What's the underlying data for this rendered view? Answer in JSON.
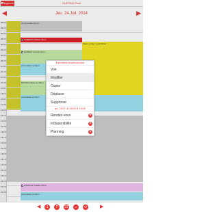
{
  "topbar": {
    "agenda_label": "Agenda",
    "doctor_name": "DUPONG Paul",
    "date": "Jeu. 24 Juil. 2014",
    "prev_arrow": "◀",
    "next_arrow": "▶"
  },
  "hours": [
    "08:00",
    "08:15",
    "08:30",
    "08:45",
    "09:00",
    "09:15",
    "09:30",
    "09:45",
    "10:00",
    "10:15",
    "10:30",
    "10:45",
    "11:00",
    "11:15",
    "11:30",
    "11:45",
    "12:00",
    "12:15",
    "12:30",
    "12:45",
    "13:00",
    "13:15",
    "13:30",
    "13:45",
    "14:00",
    "14:15",
    "14:30",
    "14:45",
    "15:00",
    "15:15",
    "15:30",
    "15:45"
  ],
  "appointments": [
    {
      "label": "[Indisponible] 30mn",
      "color": "#cfcfcf"
    },
    {
      "label": "ALBERTIN Michel   30mn",
      "color": "#e0202a"
    },
    {
      "label": "ROBERT Francis   30mn",
      "color": "#c8ecac"
    },
    {
      "label": "[Consultation] 30mn",
      "color": "#9fe3f2"
    },
    {
      "label": "MUNOZ Fabienne   30mn",
      "color": "#c8ecac"
    },
    {
      "label": "[Consultation] 30mn",
      "color": "#9fe3f2"
    },
    {
      "label": "[Sans rendez-vous] 30mn",
      "color": "#f5e825"
    },
    {
      "label": "LAVAILLE Violaine   30mn",
      "color": "#f4c4f4"
    },
    {
      "label": "[Consultation] 30mn",
      "color": "#9fe3f2"
    }
  ],
  "menu": {
    "title": "Evènement sélectionné",
    "items": [
      "Voir",
      "Modifier",
      "Copier",
      "Déplacer",
      "Supprimer"
    ],
    "info": "jeu. 24/07 de 11h00 à 11h30",
    "sub_items": [
      "Rendez-vous",
      "Indisponibilité",
      "Planning"
    ],
    "plus": "+"
  },
  "toolbar": {
    "prev": "◀",
    "next": "▶",
    "buttons": [
      "1",
      "7",
      "31",
      "⌂",
      "↺"
    ]
  },
  "colors": {
    "accent": "#e53535",
    "yellow_column": "#d5d22e",
    "unavailable": "#cfcfcf"
  }
}
